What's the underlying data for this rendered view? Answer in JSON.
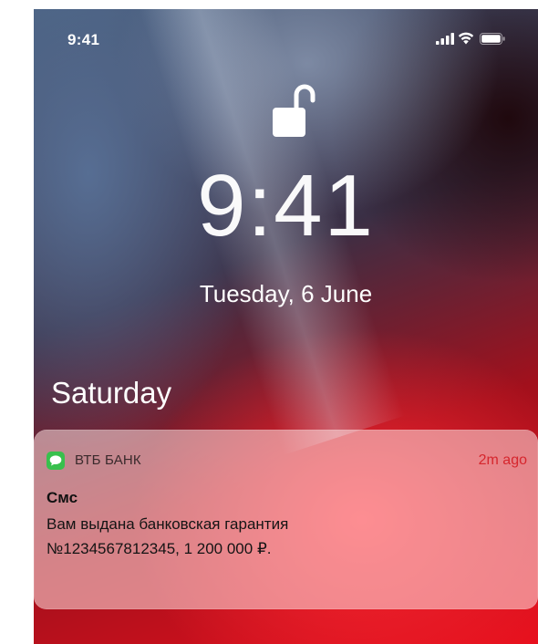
{
  "status_bar": {
    "time": "9:41"
  },
  "lock_screen": {
    "time": "9:41",
    "date": "Tuesday, 6 June"
  },
  "section": {
    "header": "Saturday"
  },
  "notification": {
    "app_name": "ВТБ БАНК",
    "time_ago": "2m ago",
    "title": "Смс",
    "body_line1": "Вам выдана банковская гарантия",
    "body_line2": "№1234567812345, 1 200 000 ₽."
  },
  "icons": {
    "status": [
      "signal-icon",
      "wifi-icon",
      "battery-icon"
    ],
    "lock": "unlocked-padlock-icon",
    "app": "messages-icon"
  },
  "colors": {
    "notification_time": "#d6262d",
    "app_icon": "#38c04d"
  }
}
